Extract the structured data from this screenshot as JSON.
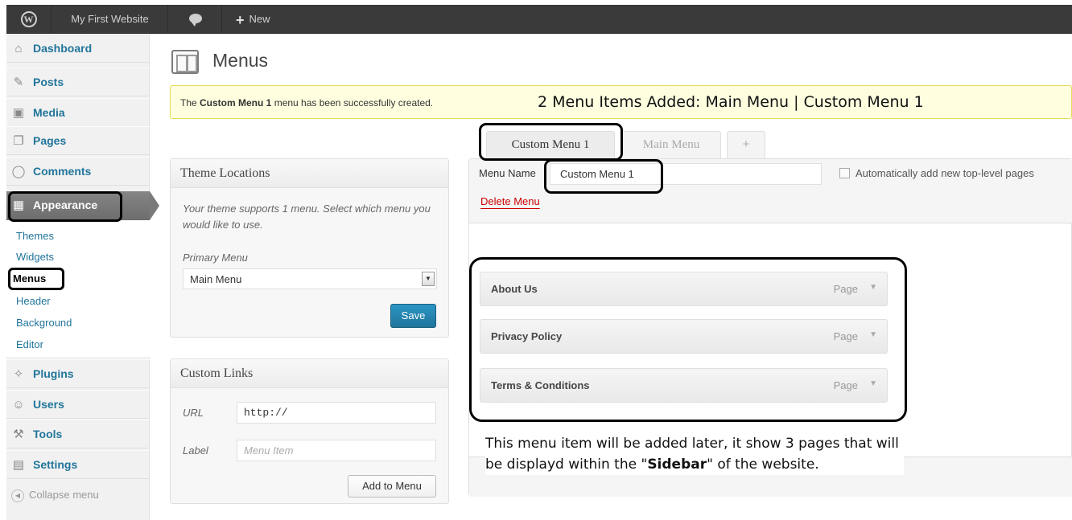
{
  "adminbar": {
    "site_name": "My First Website",
    "new_label": "New",
    "icons": {
      "logo": "wordpress-logo-icon",
      "comments": "comment-bubble-icon",
      "new": "plus-icon"
    }
  },
  "sidebar": {
    "items": [
      {
        "label": "Dashboard",
        "icon": "home-icon"
      },
      {
        "label": "Posts",
        "icon": "pin-icon"
      },
      {
        "label": "Media",
        "icon": "camera-icon"
      },
      {
        "label": "Pages",
        "icon": "pages-icon"
      },
      {
        "label": "Comments",
        "icon": "comment-icon"
      },
      {
        "label": "Appearance",
        "icon": "appearance-icon"
      },
      {
        "label": "Plugins",
        "icon": "plug-icon"
      },
      {
        "label": "Users",
        "icon": "users-icon"
      },
      {
        "label": "Tools",
        "icon": "tools-icon"
      },
      {
        "label": "Settings",
        "icon": "settings-icon"
      }
    ],
    "submenu": [
      "Themes",
      "Widgets",
      "Menus",
      "Header",
      "Background",
      "Editor"
    ],
    "collapse_label": "Collapse menu"
  },
  "page": {
    "title": "Menus"
  },
  "notice": {
    "prefix": "The ",
    "menu_name": "Custom Menu 1",
    "suffix": " menu has been successfully created.",
    "annotation": "2 Menu Items Added: Main Menu | Custom Menu 1"
  },
  "tabs": [
    {
      "label": "Custom Menu 1",
      "active": true
    },
    {
      "label": "Main Menu",
      "active": false
    },
    {
      "label": "+",
      "active": false
    }
  ],
  "theme_locations": {
    "title": "Theme Locations",
    "description": "Your theme supports 1 menu. Select which menu you would like to use.",
    "primary_label": "Primary Menu",
    "primary_value": "Main Menu",
    "save_label": "Save"
  },
  "custom_links": {
    "title": "Custom Links",
    "url_label": "URL",
    "url_value": "http://",
    "label_label": "Label",
    "label_placeholder": "Menu Item",
    "add_label": "Add to Menu"
  },
  "menu_editor": {
    "name_label": "Menu Name",
    "name_value": "Custom Menu 1",
    "auto_add_label": "Automatically add new top-level pages",
    "delete_label": "Delete Menu",
    "items": [
      {
        "title": "About Us",
        "type": "Page"
      },
      {
        "title": "Privacy Policy",
        "type": "Page"
      },
      {
        "title": "Terms & Conditions",
        "type": "Page"
      }
    ],
    "note_part1": "This menu item will be added later, it show 3 pages that will be displayd within the \"",
    "note_bold": "Sidebar",
    "note_part2": "\" of the website."
  }
}
